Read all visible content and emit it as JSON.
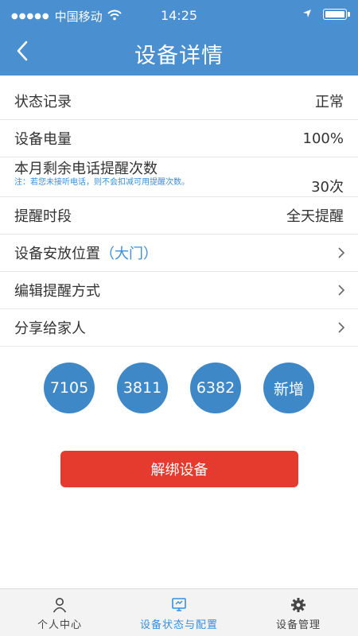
{
  "status_bar": {
    "carrier": "中国移动",
    "time": "14:25",
    "icons": [
      "signal-dots",
      "wifi-icon",
      "location-icon",
      "battery-icon"
    ]
  },
  "header": {
    "title": "设备详情",
    "back_icon": "chevron-left-icon"
  },
  "rows": {
    "status_label": "状态记录",
    "status_value": "正常",
    "battery_label": "设备电量",
    "battery_value": "100%",
    "calls_label": "本月剩余电话提醒次数",
    "calls_note": "注：若您未接听电话，则不会扣减可用提醒次数。",
    "calls_value": "30次",
    "period_label": "提醒时段",
    "period_value": "全天提醒",
    "location_label": "设备安放位置",
    "location_open": "（",
    "location_value": "大门",
    "location_close": "）",
    "method_label": "编辑提醒方式",
    "share_label": "分享给家人"
  },
  "codes": {
    "items": [
      "7105",
      "3811",
      "6382"
    ],
    "add_label": "新增"
  },
  "actions": {
    "unbind_label": "解绑设备"
  },
  "tabbar": {
    "personal_label": "个人中心",
    "status_label": "设备状态与配置",
    "manage_label": "设备管理",
    "active": "设备状态与配置"
  },
  "colors": {
    "header_bg": "#4a90d0",
    "accent": "#3a8edb",
    "code_circle": "#3f88c8",
    "danger": "#e53a2e"
  }
}
